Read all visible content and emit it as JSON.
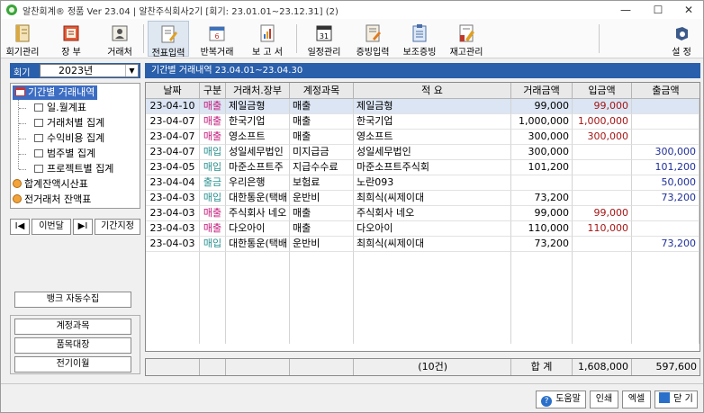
{
  "window": {
    "title": "알찬회계® 정품 Ver 23.04 | 알찬주식회사2기 [회기: 23.01.01~23.12.31] (2)",
    "min": "—",
    "max": "☐",
    "close": "✕"
  },
  "toolbar": {
    "items": [
      {
        "label": "회기관리",
        "icon": "ledger-icon"
      },
      {
        "label": "장 부",
        "icon": "book-icon"
      },
      {
        "label": "거래처",
        "icon": "contacts-icon"
      },
      {
        "label": "전표입력",
        "icon": "voucher-icon"
      },
      {
        "label": "반복거래",
        "icon": "repeat-icon"
      },
      {
        "label": "보 고 서",
        "icon": "report-icon"
      },
      {
        "label": "일정관리",
        "icon": "calendar-icon"
      },
      {
        "label": "증빙입력",
        "icon": "receipt-icon"
      },
      {
        "label": "보조증빙",
        "icon": "clipboard-icon"
      },
      {
        "label": "재고관리",
        "icon": "inventory-icon"
      },
      {
        "label": "설 정",
        "icon": "settings-icon"
      }
    ],
    "calendar_day": "31"
  },
  "sidebar": {
    "year_label": "회기",
    "year_value": "2023년",
    "tree": [
      "기간별 거래내역",
      "일.월계표",
      "거래처별 집계",
      "수익비용 집계",
      "범주별 집계",
      "프로젝트별 집계",
      "합계잔액시산표",
      "전거래처 잔액표"
    ],
    "nav": {
      "first": "I◀",
      "prev": "이번달",
      "next": "▶I",
      "range": "기간지정"
    },
    "bank_button": "뱅크 자동수집",
    "group_buttons": [
      "계정과목",
      "품목대장",
      "전기이월"
    ]
  },
  "main": {
    "range_text": "기간별 거래내역   23.04.01~23.04.30",
    "columns": [
      "날짜",
      "구분",
      "거래처.장부",
      "계정과목",
      "적 요",
      "거래금액",
      "입금액",
      "출금액"
    ],
    "rows": [
      {
        "date": "23-04-10",
        "type": "매출",
        "client": "제일금형",
        "account": "매출",
        "memo": "제일금형",
        "amount": "99,000",
        "deposit": "99,000",
        "withdraw": ""
      },
      {
        "date": "23-04-07",
        "type": "매출",
        "client": "한국기업",
        "account": "매출",
        "memo": "한국기업",
        "amount": "1,000,000",
        "deposit": "1,000,000",
        "withdraw": ""
      },
      {
        "date": "23-04-07",
        "type": "매출",
        "client": "영소프트",
        "account": "매출",
        "memo": "영소프트",
        "amount": "300,000",
        "deposit": "300,000",
        "withdraw": ""
      },
      {
        "date": "23-04-07",
        "type": "매입",
        "client": "성일세무법인",
        "account": "미지급금",
        "memo": "성일세무법인",
        "amount": "300,000",
        "deposit": "",
        "withdraw": "300,000"
      },
      {
        "date": "23-04-05",
        "type": "매입",
        "client": "마준소프트주",
        "account": "지급수수료",
        "memo": "마준소프트주식회",
        "amount": "101,200",
        "deposit": "",
        "withdraw": "101,200"
      },
      {
        "date": "23-04-04",
        "type": "출금",
        "client": "우리은행",
        "account": "보험료",
        "memo": "노란093",
        "amount": "",
        "deposit": "",
        "withdraw": "50,000"
      },
      {
        "date": "23-04-03",
        "type": "매입",
        "client": "대한통운(택배",
        "account": "운반비",
        "memo": "최희식(씨제이대",
        "amount": "73,200",
        "deposit": "",
        "withdraw": "73,200"
      },
      {
        "date": "23-04-03",
        "type": "매출",
        "client": "주식회사 네오",
        "account": "매출",
        "memo": "주식회사 네오",
        "amount": "99,000",
        "deposit": "99,000",
        "withdraw": ""
      },
      {
        "date": "23-04-03",
        "type": "매출",
        "client": "다오아이",
        "account": "매출",
        "memo": "다오아이",
        "amount": "110,000",
        "deposit": "110,000",
        "withdraw": ""
      },
      {
        "date": "23-04-03",
        "type": "매입",
        "client": "대한통운(택배",
        "account": "운반비",
        "memo": "최희식(씨제이대",
        "amount": "73,200",
        "deposit": "",
        "withdraw": "73,200"
      }
    ],
    "totals": {
      "count": "(10건)",
      "label": "합 계",
      "deposit": "1,608,000",
      "withdraw": "597,600"
    }
  },
  "footer": {
    "help": "도움말",
    "print": "인쇄",
    "excel": "엑셀",
    "close": "닫 기"
  },
  "colors": {
    "header_blue": "#2a5fab",
    "type_sales": "#c2187a",
    "type_purchase": "#2a8f8f",
    "type_out": "#2a8f8f",
    "deposit_text": "#a31515",
    "withdraw_text": "#1f2f9a",
    "selected_row": "#dbe5f3"
  }
}
